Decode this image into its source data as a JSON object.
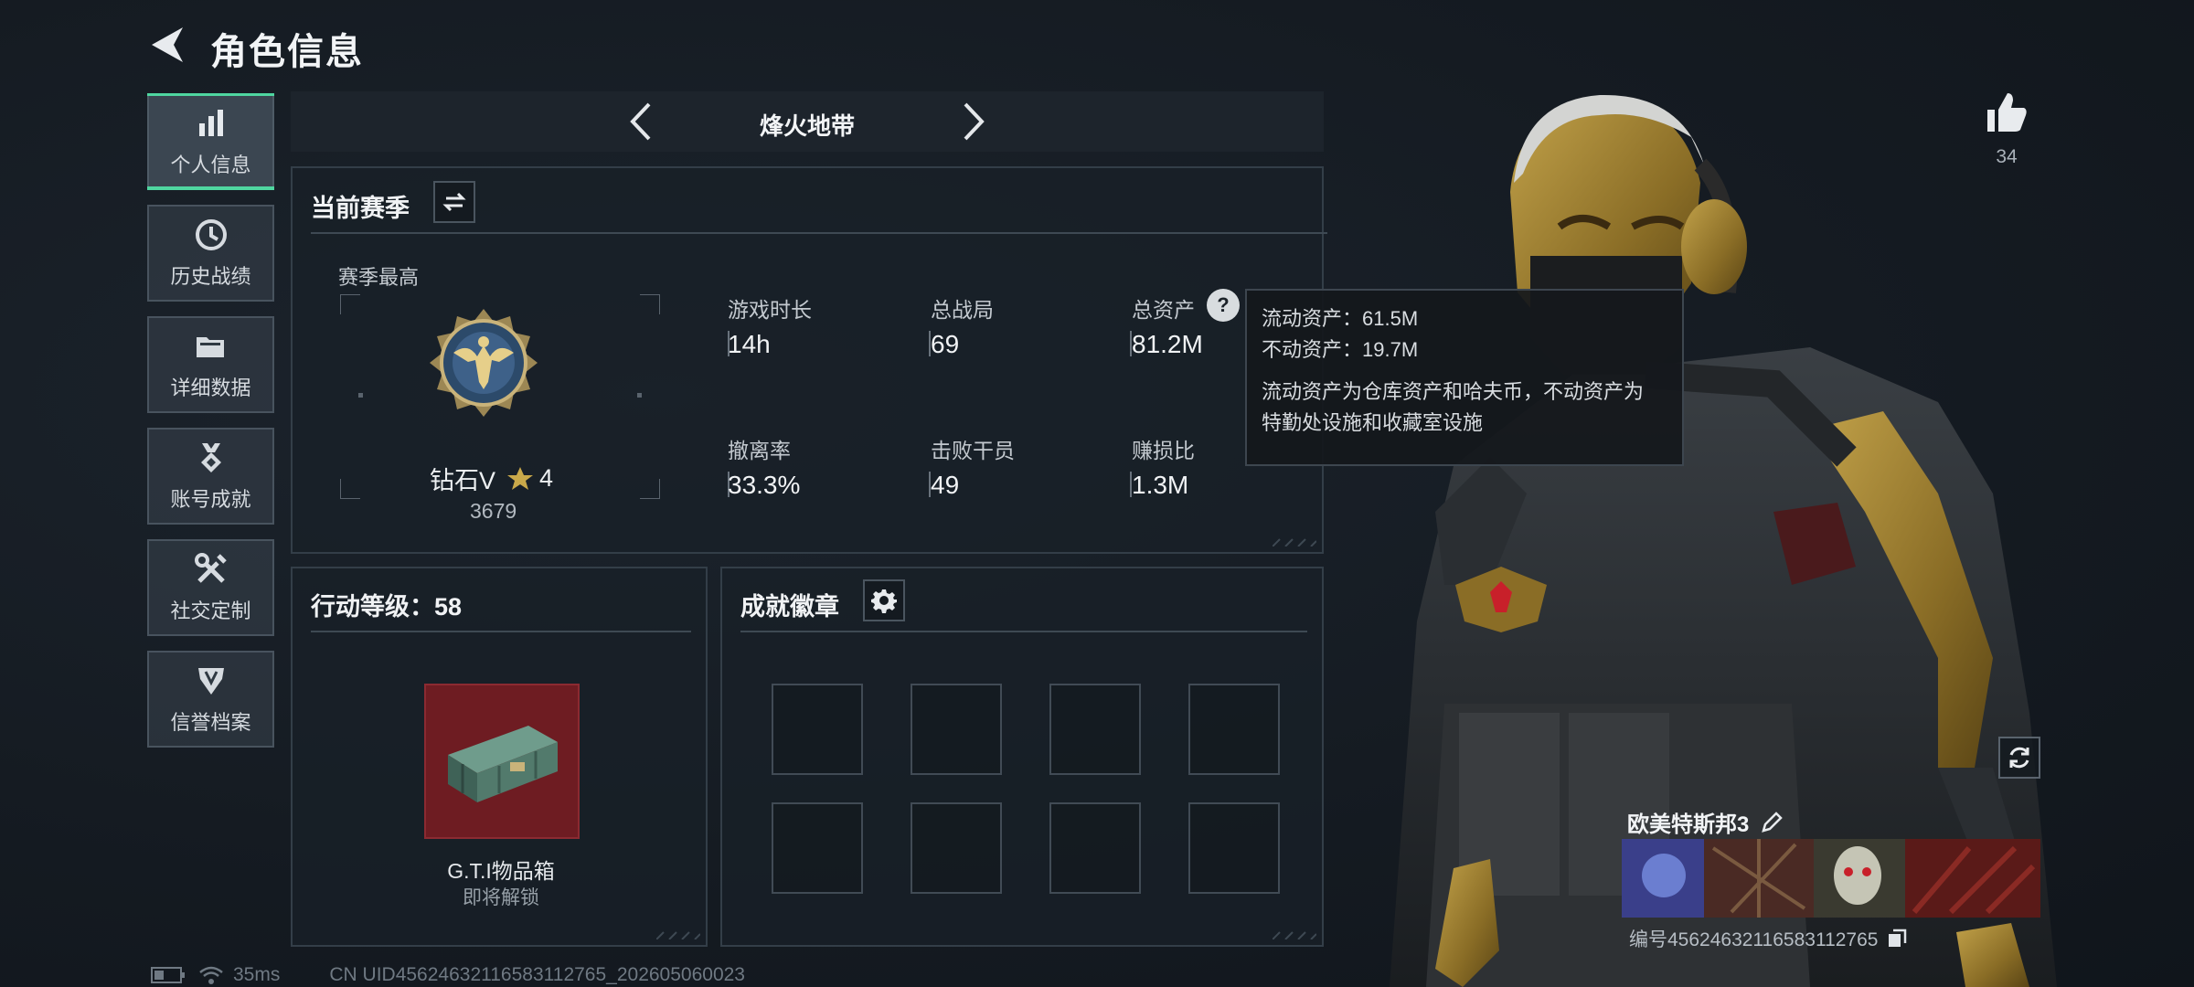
{
  "header": {
    "title": "角色信息"
  },
  "nav": {
    "items": [
      {
        "label": "个人信息",
        "icon": "bar-chart-icon",
        "active": true
      },
      {
        "label": "历史战绩",
        "icon": "clock-icon",
        "active": false
      },
      {
        "label": "详细数据",
        "icon": "folder-icon",
        "active": false
      },
      {
        "label": "账号成就",
        "icon": "medal-icon",
        "active": false
      },
      {
        "label": "社交定制",
        "icon": "tools-icon",
        "active": false
      },
      {
        "label": "信誉档案",
        "icon": "shield-icon",
        "active": false
      }
    ]
  },
  "mode": {
    "title": "烽火地带"
  },
  "season": {
    "title": "当前赛季",
    "best_label": "赛季最高",
    "rank_name": "钻石V",
    "rank_stars": "4",
    "rank_score": "3679",
    "stats": [
      {
        "label": "游戏时长",
        "value": "14h"
      },
      {
        "label": "总战局",
        "value": "69"
      },
      {
        "label": "总资产",
        "value": "81.2M"
      },
      {
        "label": "撤离率",
        "value": "33.3%"
      },
      {
        "label": "击败干员",
        "value": "49"
      },
      {
        "label": "赚损比",
        "value": "1.3M"
      }
    ]
  },
  "tooltip": {
    "liquid": "流动资产：61.5M",
    "fixed": "不动资产：19.7M",
    "desc_line1": "流动资产为仓库资产和哈夫币，不动资产为",
    "desc_line2": "特勤处设施和收藏室设施"
  },
  "action_level": {
    "title": "行动等级：58",
    "reward_name": "G.T.I物品箱",
    "reward_status": "即将解锁"
  },
  "achievements": {
    "title": "成就徽章",
    "slot_count": 8
  },
  "player": {
    "likes": "34",
    "name": "欧美特斯邦3",
    "id_label": "编号4562463211658311276​5"
  },
  "status": {
    "ping": "35ms",
    "uid": "CN UID4562463211658311276​5_202605060023"
  },
  "colors": {
    "accent": "#4fd6a0",
    "gold": "#c9a94a",
    "reward_bg": "#6e1c22"
  }
}
